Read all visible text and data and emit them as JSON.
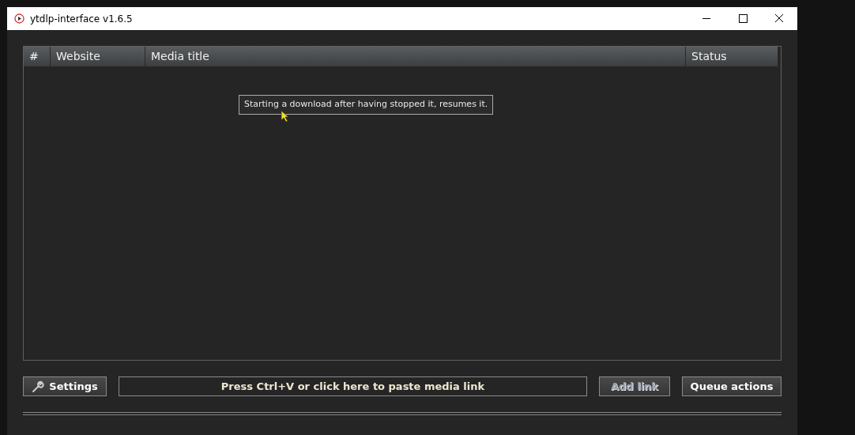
{
  "window": {
    "title": "ytdlp-interface v1.6.5"
  },
  "table": {
    "columns": [
      {
        "label": "#"
      },
      {
        "label": "Website"
      },
      {
        "label": "Media title"
      },
      {
        "label": "Status"
      }
    ]
  },
  "tooltip": {
    "text": "Starting a download after having stopped it, resumes it."
  },
  "settings_button": {
    "label": "Settings"
  },
  "link_field": {
    "placeholder": "Press Ctrl+V or click here to paste media link"
  },
  "buttons": [
    {
      "label": "Add link",
      "disabled": true
    },
    {
      "label": "Queue actions",
      "disabled": false
    }
  ]
}
